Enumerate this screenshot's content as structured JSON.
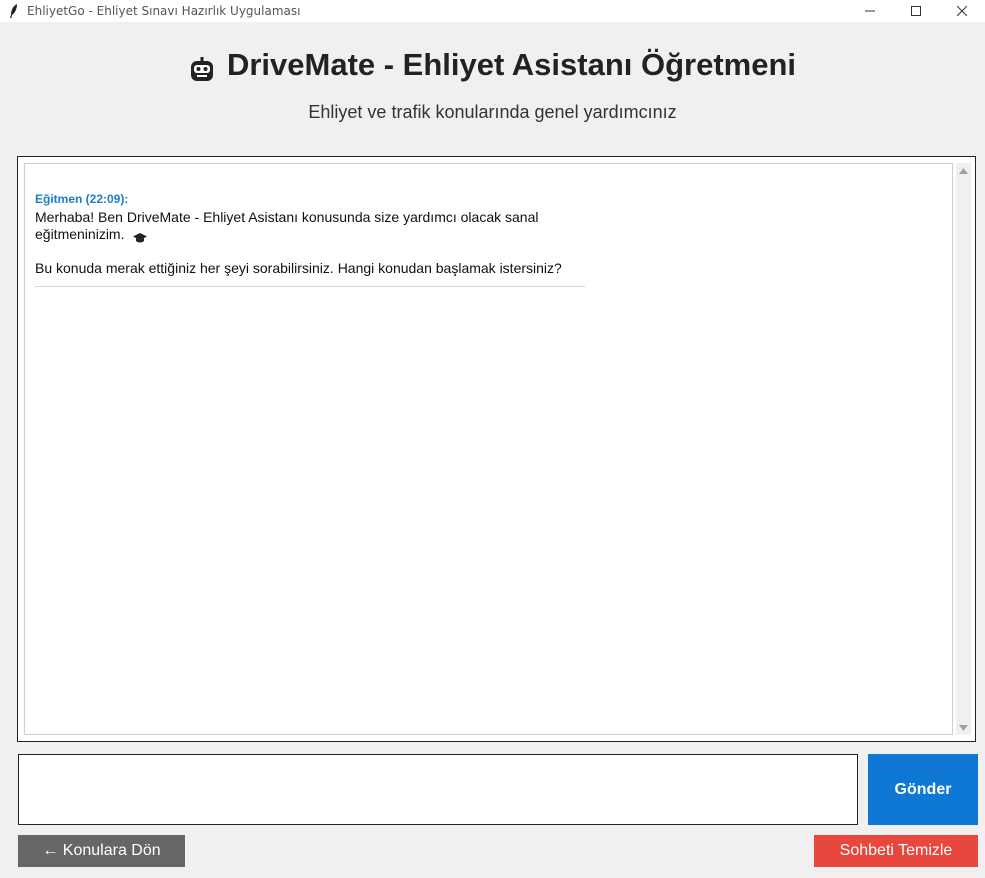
{
  "window": {
    "title": "EhliyetGo - Ehliyet Sınavı Hazırlık Uygulaması",
    "app_icon": "feather-icon",
    "controls": [
      "minimize-icon",
      "maximize-icon",
      "close-icon"
    ]
  },
  "header": {
    "icon": "robot-icon",
    "title": "DriveMate - Ehliyet Asistanı Öğretmeni",
    "subtitle": "Ehliyet ve trafik konularında genel yardımcınız"
  },
  "chat": {
    "messages": [
      {
        "sender": "Eğitmen (22:09):",
        "line1": "Merhaba! Ben DriveMate - Ehliyet Asistanı konusunda size yardımcı olacak sanal eğitmeninizim.",
        "line1_icon": "graduation-cap-icon",
        "line2": "Bu konuda merak ettiğiniz her şeyi sorabilirsiniz. Hangi konudan başlamak istersiniz?"
      }
    ]
  },
  "input": {
    "value": "",
    "placeholder": ""
  },
  "buttons": {
    "send": "Gönder",
    "back": "← Konulara Dön",
    "clear": "Sohbeti Temizle"
  },
  "colors": {
    "send": "#0f78d4",
    "back": "#666666",
    "clear": "#e8473e",
    "sender": "#1a7fc4",
    "background": "#f0f0f0"
  }
}
